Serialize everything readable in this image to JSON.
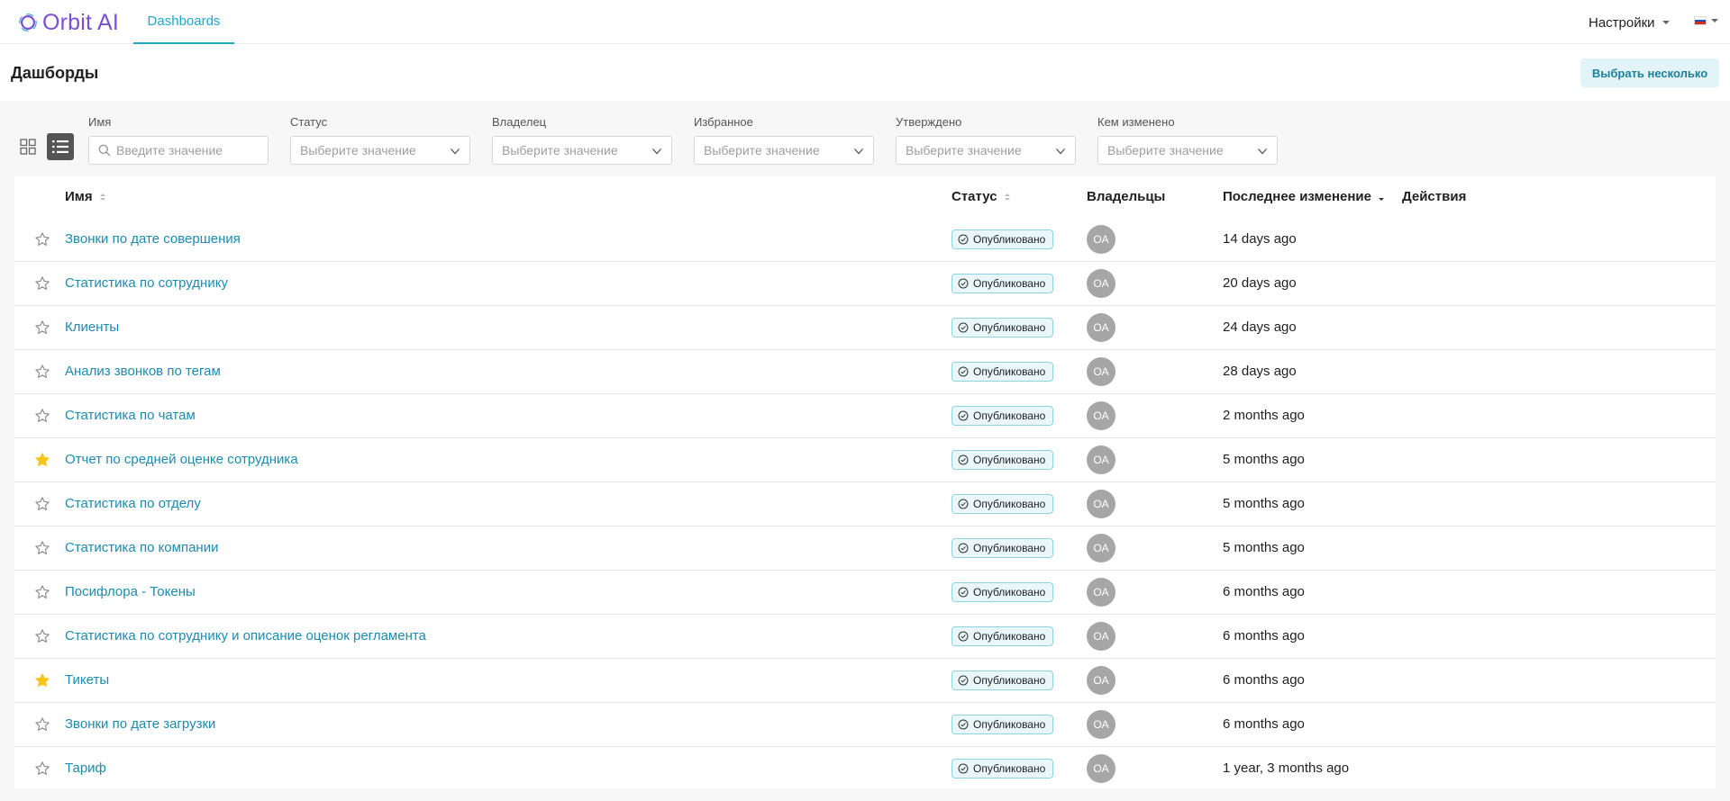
{
  "header": {
    "logo_text": "Orbit AI",
    "nav_tab": "Dashboards",
    "settings_label": "Настройки",
    "language": "RU"
  },
  "page": {
    "title": "Дашборды",
    "select_many_label": "Выбрать несколько"
  },
  "filters": {
    "name": {
      "label": "Имя",
      "placeholder": "Введите значение"
    },
    "status": {
      "label": "Статус",
      "placeholder": "Выберите значение"
    },
    "owner": {
      "label": "Владелец",
      "placeholder": "Выберите значение"
    },
    "favorite": {
      "label": "Избранное",
      "placeholder": "Выберите значение"
    },
    "approved": {
      "label": "Утверждено",
      "placeholder": "Выберите значение"
    },
    "changed_by": {
      "label": "Кем изменено",
      "placeholder": "Выберите значение"
    }
  },
  "table": {
    "columns": {
      "name": "Имя",
      "status": "Статус",
      "owners": "Владельцы",
      "modified": "Последнее изменение",
      "actions": "Действия"
    },
    "rows": [
      {
        "name": "Звонки по дате совершения",
        "status": "Опубликовано",
        "owner": "OA",
        "modified": "14 days ago",
        "favorite": false
      },
      {
        "name": "Статистика по сотруднику",
        "status": "Опубликовано",
        "owner": "OA",
        "modified": "20 days ago",
        "favorite": false
      },
      {
        "name": "Клиенты",
        "status": "Опубликовано",
        "owner": "OA",
        "modified": "24 days ago",
        "favorite": false
      },
      {
        "name": "Анализ звонков по тегам",
        "status": "Опубликовано",
        "owner": "OA",
        "modified": "28 days ago",
        "favorite": false
      },
      {
        "name": "Статистика по чатам",
        "status": "Опубликовано",
        "owner": "OA",
        "modified": "2 months ago",
        "favorite": false
      },
      {
        "name": "Отчет по средней оценке сотрудника",
        "status": "Опубликовано",
        "owner": "OA",
        "modified": "5 months ago",
        "favorite": true
      },
      {
        "name": "Статистика по отделу",
        "status": "Опубликовано",
        "owner": "OA",
        "modified": "5 months ago",
        "favorite": false
      },
      {
        "name": "Статистика по компании",
        "status": "Опубликовано",
        "owner": "OA",
        "modified": "5 months ago",
        "favorite": false
      },
      {
        "name": "Посифлора - Токены",
        "status": "Опубликовано",
        "owner": "OA",
        "modified": "6 months ago",
        "favorite": false
      },
      {
        "name": "Статистика по сотруднику и описание оценок регламента",
        "status": "Опубликовано",
        "owner": "OA",
        "modified": "6 months ago",
        "favorite": false
      },
      {
        "name": "Тикеты",
        "status": "Опубликовано",
        "owner": "OA",
        "modified": "6 months ago",
        "favorite": true
      },
      {
        "name": "Звонки по дате загрузки",
        "status": "Опубликовано",
        "owner": "OA",
        "modified": "6 months ago",
        "favorite": false
      },
      {
        "name": "Тариф",
        "status": "Опубликовано",
        "owner": "OA",
        "modified": "1 year, 3 months ago",
        "favorite": false
      }
    ]
  },
  "colors": {
    "brand": "#7a4fd6",
    "accent": "#20a7c9",
    "link": "#1b8cb0",
    "favorite_star": "#f5c518",
    "status_border": "#8fd3e3"
  },
  "icons": {
    "logo": "orbit-ring-icon",
    "grid_view": "grid-view-icon",
    "list_view": "list-view-icon",
    "search": "search-icon",
    "dropdown": "chevron-down-icon",
    "favorite": "star-icon",
    "status": "check-circle-icon"
  }
}
